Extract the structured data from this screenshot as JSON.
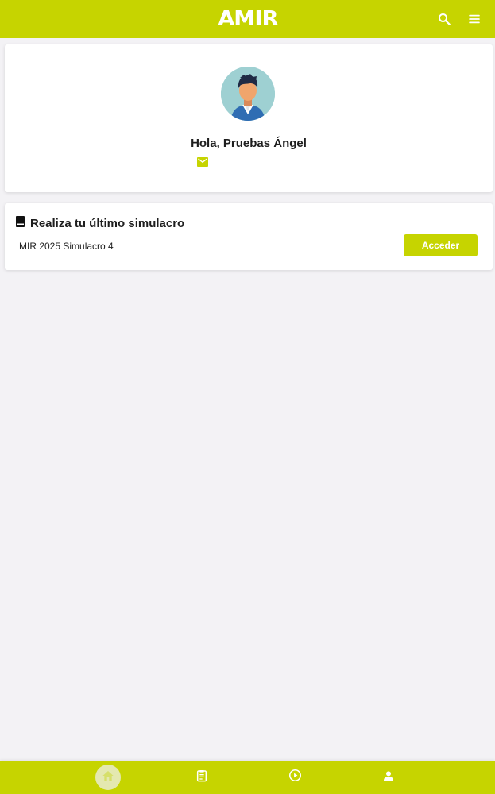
{
  "header": {
    "logo_text": "AMIR",
    "icons": [
      "search-icon",
      "menu-icon"
    ]
  },
  "profile": {
    "greeting": "Hola, Pruebas Ángel",
    "avatar": "user-avatar",
    "email_icon": "mail-icon"
  },
  "simulacro": {
    "title": "Realiza tu último simulacro",
    "title_icon": "book-icon",
    "name": "MIR 2025 Simulacro 4",
    "button_label": "Acceder"
  },
  "bottom_nav": {
    "items": [
      {
        "icon": "home-icon",
        "active": true
      },
      {
        "icon": "clipboard-icon",
        "active": false
      },
      {
        "icon": "play-circle-icon",
        "active": false
      },
      {
        "icon": "person-icon",
        "active": false
      }
    ]
  },
  "colors": {
    "accent": "#c6d400",
    "background": "#f3f2f5",
    "card": "#ffffff"
  }
}
